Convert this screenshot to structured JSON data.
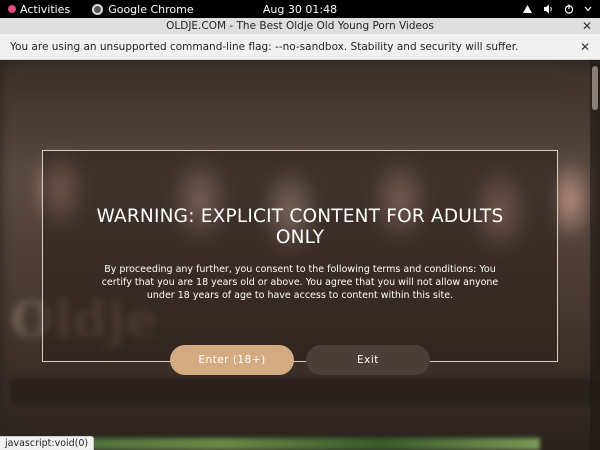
{
  "topbar": {
    "activities": "Activities",
    "app_name": "Google Chrome",
    "clock": "Aug 30  01:48",
    "tray_icons": [
      "network-icon",
      "volume-icon",
      "power-icon"
    ]
  },
  "window": {
    "title": "OLDJE.COM - The Best Oldje Old Young Porn Videos"
  },
  "infobar": {
    "message": "You are using an unsupported command-line flag: --no-sandbox. Stability and security will suffer."
  },
  "modal": {
    "heading": "WARNING: EXPLICIT CONTENT FOR ADULTS ONLY",
    "body": "By proceeding any further, you consent to the following terms and conditions: You certify that you are 18 years old or above. You agree that you will not allow anyone under 18 years of age to have access to content within this site.",
    "enter_label": "Enter (18+)",
    "exit_label": "Exit"
  },
  "status": {
    "url": "javascript:void(0)"
  },
  "colors": {
    "enter_button": "#d4aa82",
    "exit_button": "#4b3d38",
    "modal_border": "#d9cfc8"
  }
}
